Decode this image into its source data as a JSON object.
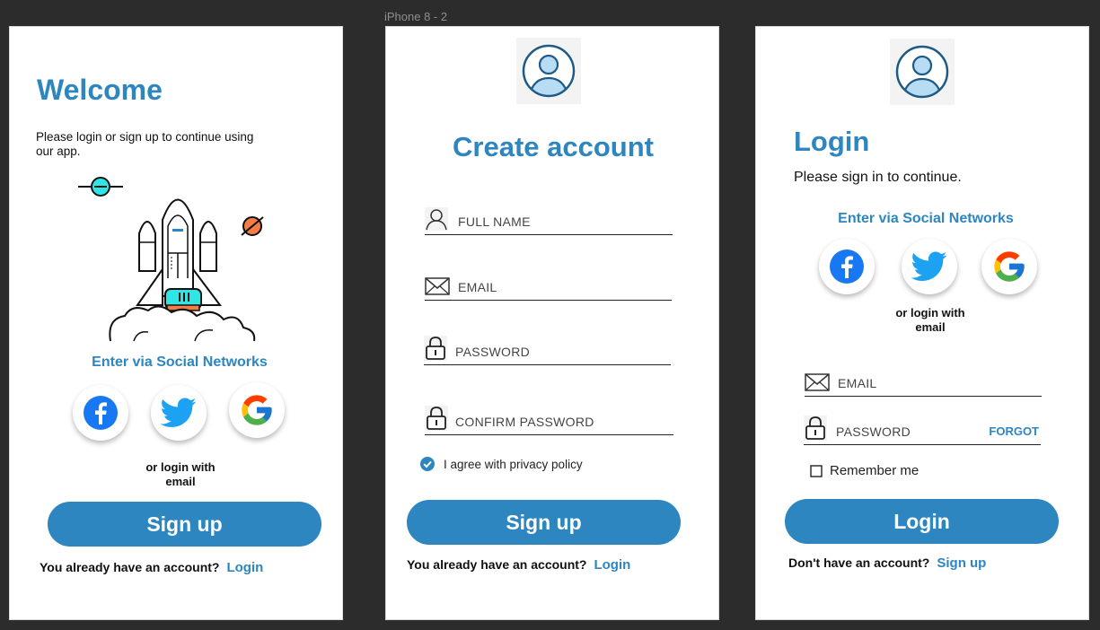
{
  "frame_label": "iPhone 8 - 2",
  "welcome": {
    "title": "Welcome",
    "subtitle": "Please login or sign up to continue using our app.",
    "social_heading": "Enter via Social Networks",
    "or_login": "or login with email",
    "signup_button": "Sign up",
    "footer_text": "You already have an account?",
    "footer_link": "Login"
  },
  "create_account": {
    "title": "Create account",
    "fields": {
      "full_name": "FULL NAME",
      "email": "EMAIL",
      "password": "PASSWORD",
      "confirm_password": "CONFIRM PASSWORD"
    },
    "agree_label": "I agree with privacy policy",
    "signup_button": "Sign up",
    "footer_text": "You already have an account?",
    "footer_link": "Login"
  },
  "login": {
    "title": "Login",
    "subtitle": "Please sign in to continue.",
    "social_heading": "Enter via Social Networks",
    "or_login": "or login with email",
    "fields": {
      "email": "EMAIL",
      "password": "PASSWORD"
    },
    "forgot": "FORGOT",
    "remember": "Remember me",
    "login_button": "Login",
    "footer_text": "Don't have an account?",
    "footer_link": "Sign up"
  },
  "colors": {
    "accent": "#2d86c0",
    "facebook": "#1877f2",
    "twitter": "#1da1f2"
  },
  "icons": [
    "planet-icon",
    "rocket-illustration",
    "facebook-icon",
    "twitter-icon",
    "google-icon",
    "user-avatar-icon",
    "user-icon",
    "mail-icon",
    "lock-icon",
    "check-circle-icon",
    "checkbox-icon"
  ]
}
